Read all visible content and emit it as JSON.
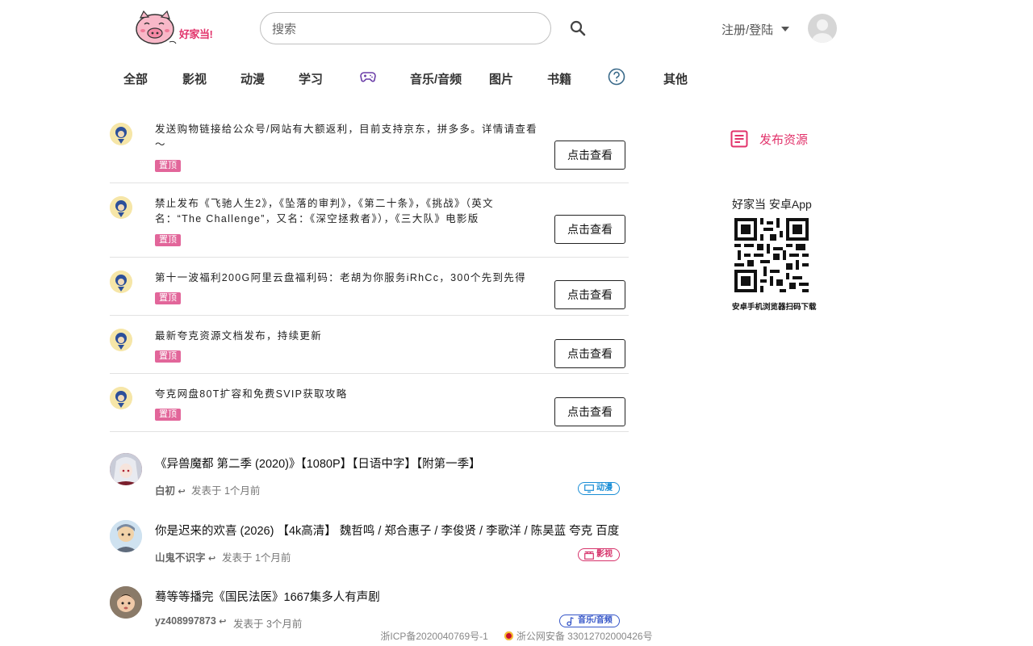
{
  "header": {
    "logo_text": "好家当!",
    "search_placeholder": "搜索",
    "login_label": "注册/登陆"
  },
  "nav": {
    "categories": [
      "全部",
      "影视",
      "动漫",
      "学习",
      "音乐/音频",
      "图片",
      "书籍",
      "其他"
    ],
    "icon_items": [
      "gamepad-icon",
      "help-circle-icon"
    ]
  },
  "pinned": [
    {
      "title": "发送购物链接给公众号/网站有大额返利，目前支持京东，拼多多。详情请查看～",
      "tag": "置顶",
      "button": "点击查看"
    },
    {
      "title": "禁止发布《飞驰人生2》，《坠落的审判》，《第二十条》，《挑战》（英文名：“The Challenge”，又名：《深空拯救者》），《三大队》电影版",
      "tag": "置顶",
      "button": "点击查看"
    },
    {
      "title": "第十一波福利200G阿里云盘福利码：老胡为你服务iRhCc，300个先到先得",
      "tag": "置顶",
      "button": "点击查看"
    },
    {
      "title": "最新夸克资源文档发布，持续更新",
      "tag": "置顶",
      "button": "点击查看"
    },
    {
      "title": "夸克网盘80T扩容和免费SVIP获取攻略",
      "tag": "置顶",
      "button": "点击查看"
    }
  ],
  "posts": [
    {
      "title": "《异兽魔都 第二季 (2020)》【1080P】【日语中字】【附第一季】",
      "author": "白初",
      "time": "发表于 1个月前",
      "category": "动漫",
      "color": "#1a8ed6"
    },
    {
      "title": "你是迟来的欢喜 (2026) 【4k高清】 魏哲鸣 / 郑合惠子 / 李俊贤 / 李歌洋 / 陈昊蓝 夸克 百度",
      "author": "山鬼不识字",
      "time": "发表于 1个月前",
      "category": "影视",
      "color": "#d6336b"
    },
    {
      "title": "蓦等等播完《国民法医》1667集多人有声剧",
      "author": "yz408997873",
      "time": "发表于 3个月前",
      "category": "音乐/音频",
      "color": "#3656c8"
    }
  ],
  "sidebar": {
    "publish_label": "发布资源",
    "app_title": "好家当 安卓App",
    "qr_caption": "安卓手机浏览器扫码下载"
  },
  "footer": {
    "icp": "浙ICP备2020040769号-1",
    "police": "浙公网安备 33012702000426号"
  },
  "colors": {
    "brand_pink": "#e2336b",
    "tag_pink": "#e2669a"
  }
}
